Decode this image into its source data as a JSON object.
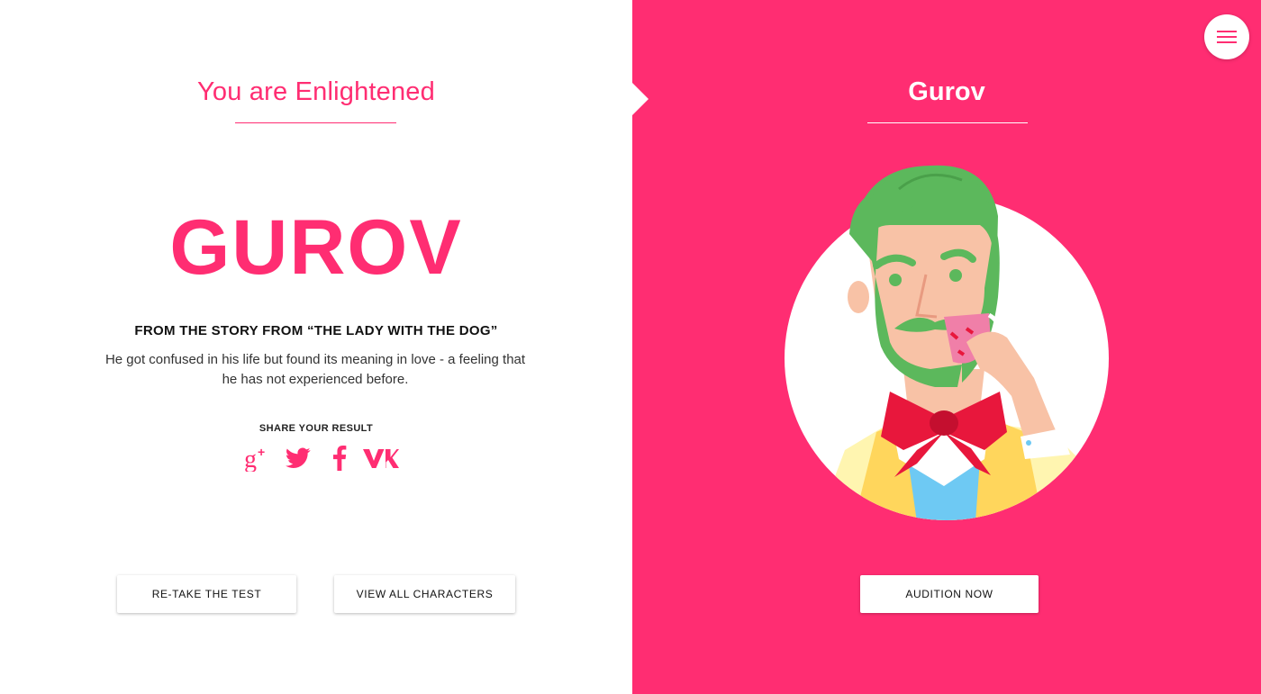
{
  "left": {
    "result_title": "You are Enlightened",
    "character_name": "GUROV",
    "source": "FROM THE STORY FROM “THE LADY WITH THE DOG”",
    "description": "He got confused in his life but found its meaning in love - a feeling that he has not experienced before.",
    "share_label": "SHARE YOUR RESULT",
    "share_icons": [
      "google-plus-icon",
      "twitter-icon",
      "facebook-icon",
      "vk-icon"
    ],
    "buttons": {
      "retake": "RE-TAKE THE TEST",
      "view_all": "VIEW ALL CHARACTERS"
    }
  },
  "right": {
    "character_title": "Gurov",
    "audition_button": "AUDITION NOW",
    "menu_icon": "hamburger-menu-icon"
  },
  "colors": {
    "accent": "#ff2d72",
    "background": "#ffffff",
    "text": "#111111",
    "beard": "#5cb85c",
    "bow": "#e8173c"
  }
}
